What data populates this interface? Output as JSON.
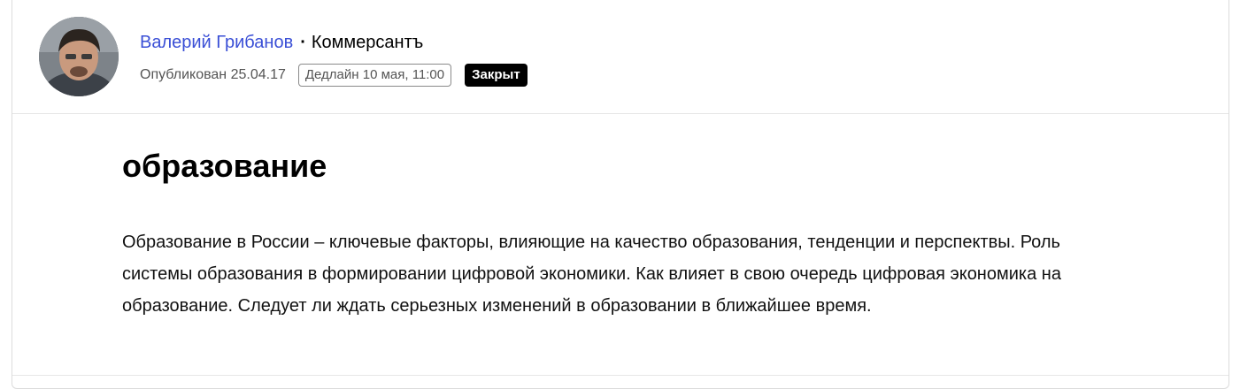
{
  "author": {
    "name": "Валерий Грибанов",
    "separator": "·",
    "publication": "Коммерсантъ"
  },
  "meta": {
    "published": "Опубликован 25.04.17",
    "deadline": "Дедлайн 10 мая, 11:00",
    "status": "Закрыт"
  },
  "post": {
    "title": "образование",
    "description": "Образование в России – ключевые факторы, влияющие на качество образования, тенденции и перспектвы. Роль системы образования в формировании цифровой экономики. Как влияет в свою очередь цифровая экономика на образование. Следует ли ждать серьезных изменений в образовании в ближайшее время."
  },
  "colors": {
    "author_link": "#3a4fd6",
    "status_bg": "#000000",
    "border": "#dcdcdc"
  }
}
